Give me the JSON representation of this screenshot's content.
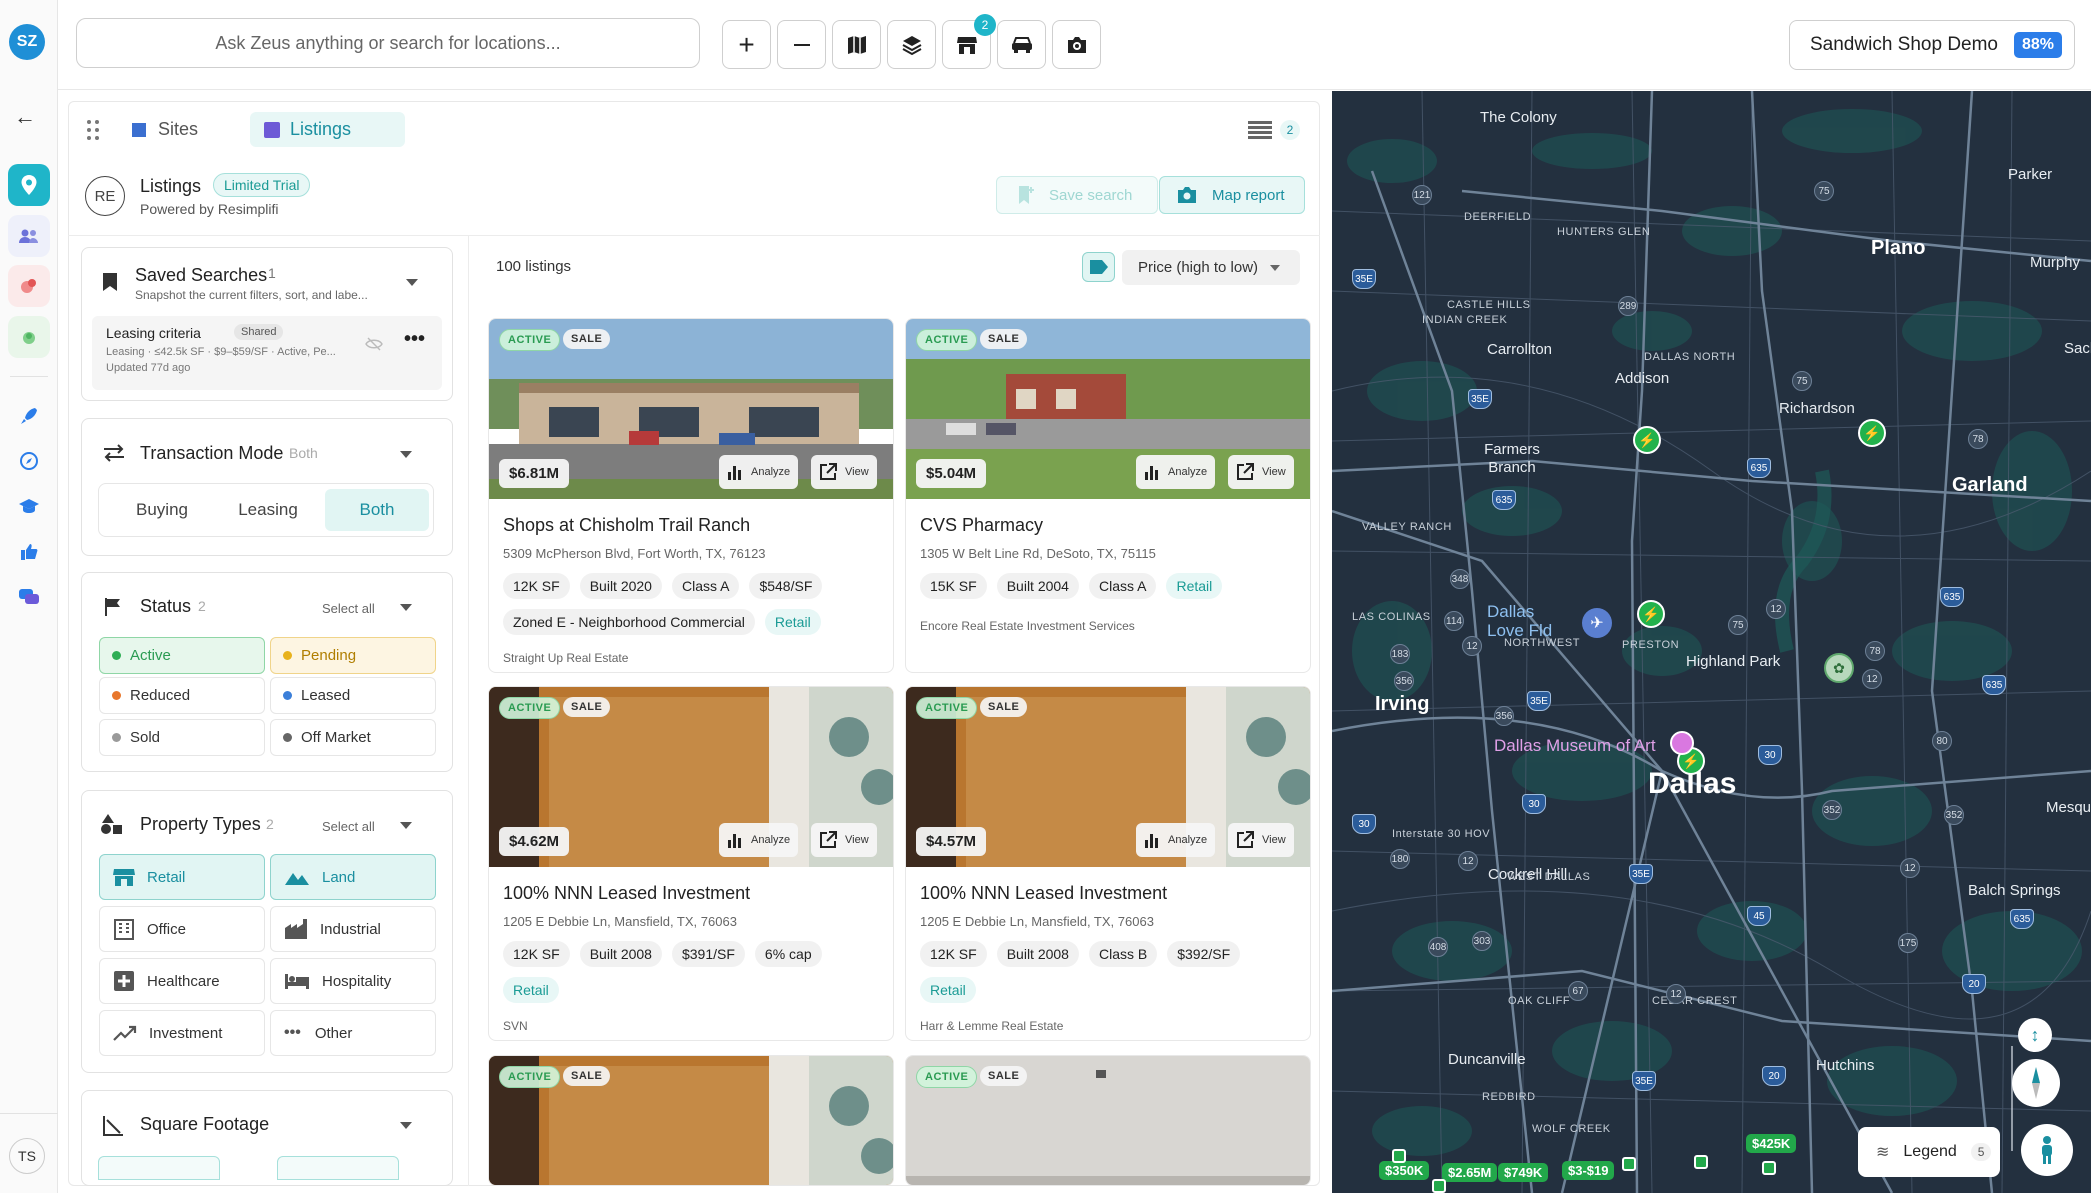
{
  "app": {
    "logo": "SZ"
  },
  "search": {
    "placeholder": "Ask Zeus anything or search for locations..."
  },
  "toolbar": {
    "store_badge": "2"
  },
  "demo": {
    "name": "Sandwich Shop Demo",
    "progress": "88%"
  },
  "rail": {
    "avatar": "TS"
  },
  "tabs": [
    {
      "label": "Sites"
    },
    {
      "label": "Listings"
    }
  ],
  "list_count_badge": "2",
  "provider": {
    "logo": "RE",
    "title": "Listings",
    "trial_badge": "Limited Trial",
    "powered_by": "Powered by Resimplifi"
  },
  "actions": {
    "save_search": "Save search",
    "map_report": "Map report"
  },
  "saved_searches": {
    "title": "Saved Searches",
    "count": "1",
    "subtitle": "Snapshot the current filters, sort, and labe...",
    "item": {
      "name": "Leasing criteria",
      "badge": "Shared",
      "summary": "Leasing · ≤42.5k SF · $9–$59/SF · Active, Pe...",
      "updated": "Updated 77d ago"
    }
  },
  "transaction_mode": {
    "title": "Transaction Mode",
    "value": "Both",
    "options": [
      "Buying",
      "Leasing",
      "Both"
    ],
    "selected": "Both"
  },
  "status": {
    "title": "Status",
    "count": "2",
    "select_all": "Select all",
    "options": [
      {
        "label": "Active",
        "color": "#2fae55",
        "selected": true
      },
      {
        "label": "Pending",
        "color": "#e8b21c",
        "selected": true
      },
      {
        "label": "Reduced",
        "color": "#e8772c",
        "selected": false
      },
      {
        "label": "Leased",
        "color": "#3b7fd9",
        "selected": false
      },
      {
        "label": "Sold",
        "color": "#9a9a9a",
        "selected": false
      },
      {
        "label": "Off Market",
        "color": "#666666",
        "selected": false
      }
    ]
  },
  "property_types": {
    "title": "Property Types",
    "count": "2",
    "select_all": "Select all",
    "options": [
      {
        "label": "Retail",
        "icon": "store-icon",
        "selected": true
      },
      {
        "label": "Land",
        "icon": "land-icon",
        "selected": true
      },
      {
        "label": "Office",
        "icon": "office-icon",
        "selected": false
      },
      {
        "label": "Industrial",
        "icon": "factory-icon",
        "selected": false
      },
      {
        "label": "Healthcare",
        "icon": "healthcare-icon",
        "selected": false
      },
      {
        "label": "Hospitality",
        "icon": "bed-icon",
        "selected": false
      },
      {
        "label": "Investment",
        "icon": "trend-icon",
        "selected": false
      },
      {
        "label": "Other",
        "icon": "more-icon",
        "selected": false
      }
    ]
  },
  "square_footage": {
    "title": "Square Footage"
  },
  "results": {
    "count_label": "100 listings",
    "sort": "Price (high to low)"
  },
  "listings": [
    {
      "status": "ACTIVE",
      "type": "SALE",
      "price": "$6.81M",
      "title": "Shops at Chisholm Trail Ranch",
      "address": "5309 McPherson Blvd, Fort Worth, TX, 76123",
      "tags": [
        "12K SF",
        "Built 2020",
        "Class A",
        "$548/SF",
        "Zoned E - Neighborhood Commercial"
      ],
      "category": "Retail",
      "broker": "Straight Up Real Estate",
      "analyze": "Analyze",
      "view": "View",
      "photo": "strip-mall"
    },
    {
      "status": "ACTIVE",
      "type": "SALE",
      "price": "$5.04M",
      "title": "CVS Pharmacy",
      "address": "1305 W Belt Line Rd, DeSoto, TX, 75115",
      "tags": [
        "15K SF",
        "Built 2004",
        "Class A"
      ],
      "category": "Retail",
      "broker": "Encore Real Estate Investment Services",
      "analyze": "Analyze",
      "view": "View",
      "photo": "pharmacy"
    },
    {
      "status": "ACTIVE",
      "type": "SALE",
      "price": "$4.62M",
      "title": "100% NNN Leased Investment",
      "address": "1205 E Debbie Ln, Mansfield, TX, 76063",
      "tags": [
        "12K SF",
        "Built 2008",
        "$391/SF",
        "6% cap"
      ],
      "category": "Retail",
      "broker": "SVN",
      "analyze": "Analyze",
      "view": "View",
      "photo": "interior"
    },
    {
      "status": "ACTIVE",
      "type": "SALE",
      "price": "$4.57M",
      "title": "100% NNN Leased Investment",
      "address": "1205 E Debbie Ln, Mansfield, TX, 76063",
      "tags": [
        "12K SF",
        "Built 2008",
        "Class B",
        "$392/SF"
      ],
      "category": "Retail",
      "broker": "Harr & Lemme Real Estate",
      "analyze": "Analyze",
      "view": "View",
      "photo": "interior"
    },
    {
      "status": "ACTIVE",
      "type": "SALE",
      "photo": "interior"
    },
    {
      "status": "ACTIVE",
      "type": "SALE",
      "photo": "wall"
    }
  ],
  "map": {
    "cities": [
      "The Colony",
      "Plano",
      "Carrollton",
      "Addison",
      "Richardson",
      "Farmers Branch",
      "Garland",
      "Dallas Love Fld",
      "Highland Park",
      "Irving",
      "Dallas",
      "Cockrell Hill",
      "Balch Springs",
      "Duncanville",
      "Hutchins",
      "Murphy",
      "Parker",
      "Sachse",
      "Mesquite"
    ],
    "museum": "Dallas Museum of Art",
    "price_pins": [
      "$350K",
      "$2.65M",
      "$749K",
      "$3-$19",
      "$425K"
    ],
    "legend": {
      "label": "Legend",
      "count": "5"
    }
  }
}
